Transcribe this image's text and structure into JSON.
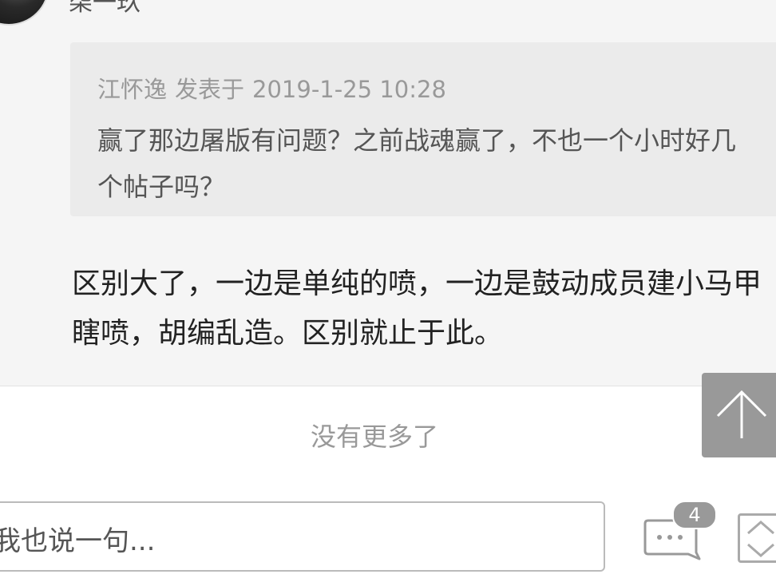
{
  "post": {
    "author_name": "柒一玖"
  },
  "quote": {
    "author": "江怀逸",
    "posted_label": "发表于",
    "timestamp": "2019-1-25 10:28",
    "text": "赢了那边屠版有问题？之前战魂赢了，不也一个小时好几个帖子吗？"
  },
  "reply": {
    "text": "区别大了，一边是单纯的喷，一边是鼓动成员建小马甲瞎喷，胡编乱造。区别就止于此。"
  },
  "list_end": {
    "label": "没有更多了"
  },
  "bottom_bar": {
    "input_placeholder": "我也说一句...",
    "comment_count": "4"
  },
  "icons": {
    "back_to_top": "arrow-up-icon",
    "comments": "comment-bubble-icon",
    "scroll": "scroll-up-down-icon"
  },
  "colors": {
    "badge": "#999999",
    "back_to_top": "#999999",
    "quote_background": "#ebebeb"
  }
}
